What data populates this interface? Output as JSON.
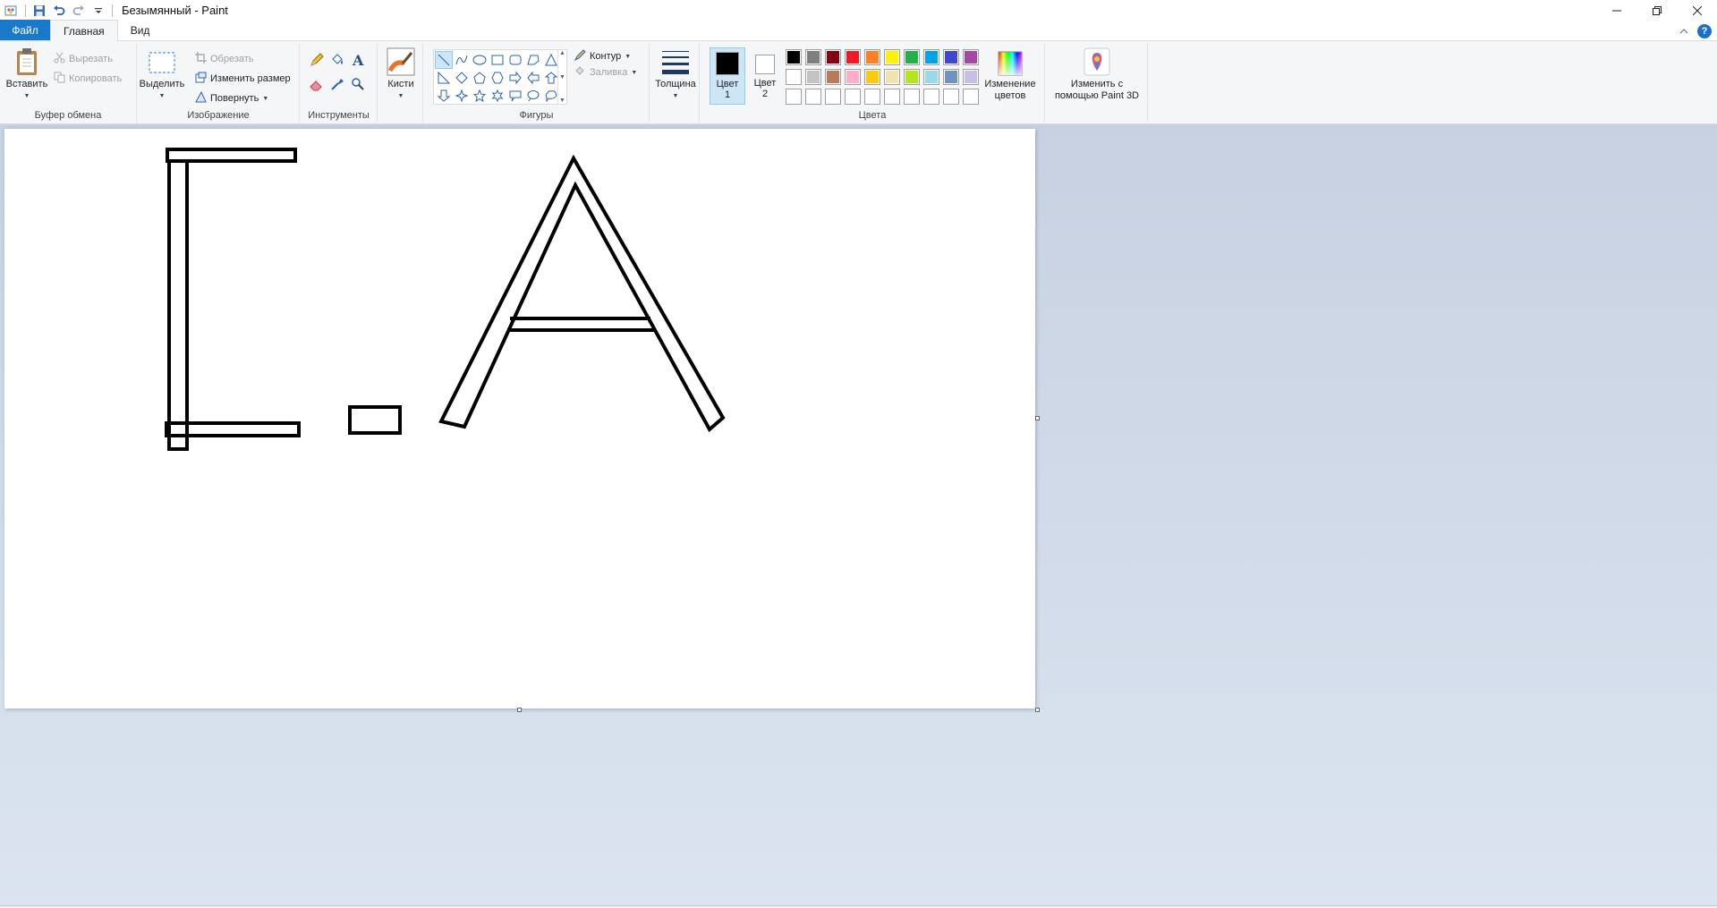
{
  "window": {
    "title": "Безымянный - Paint"
  },
  "quick_access": {
    "icons": [
      "paint-app-icon",
      "save-icon",
      "undo-icon",
      "redo-icon",
      "customize-icon"
    ]
  },
  "tabs": {
    "file": "Файл",
    "home": "Главная",
    "view": "Вид"
  },
  "ribbon": {
    "clipboard": {
      "label": "Буфер обмена",
      "paste": "Вставить",
      "cut": "Вырезать",
      "copy": "Копировать"
    },
    "image": {
      "label": "Изображение",
      "select": "Выделить",
      "crop": "Обрезать",
      "resize": "Изменить размер",
      "rotate": "Повернуть"
    },
    "tools": {
      "label": "Инструменты"
    },
    "brushes": {
      "label": "Кисти"
    },
    "shapes": {
      "label": "Фигуры",
      "outline": "Контур",
      "fill": "Заливка"
    },
    "size": {
      "label": "Толщина"
    },
    "colors": {
      "label": "Цвета",
      "color1": "Цвет\n1",
      "color1_line1": "Цвет",
      "color1_line2": "1",
      "color2_line1": "Цвет",
      "color2_line2": "2",
      "color1_value": "#000000",
      "color2_value": "#ffffff",
      "edit_line1": "Изменение",
      "edit_line2": "цветов",
      "palette_row1": [
        "#000000",
        "#7f7f7f",
        "#880015",
        "#ed1c24",
        "#ff7f27",
        "#fff200",
        "#22b14c",
        "#00a2e8",
        "#3f48cc",
        "#a349a4"
      ],
      "palette_row2": [
        "#ffffff",
        "#c3c3c3",
        "#b97a57",
        "#ffaec9",
        "#ffc90e",
        "#efe4b0",
        "#b5e61d",
        "#99d9ea",
        "#7092be",
        "#c8bfe7"
      ],
      "palette_row3": [
        "#ffffff",
        "#ffffff",
        "#ffffff",
        "#ffffff",
        "#ffffff",
        "#ffffff",
        "#ffffff",
        "#ffffff",
        "#ffffff",
        "#ffffff"
      ]
    },
    "paint3d": {
      "line1": "Изменить с",
      "line2": "помощью Paint 3D"
    }
  },
  "canvas": {
    "background": "#ffffff",
    "stroke_color": "#000000"
  }
}
